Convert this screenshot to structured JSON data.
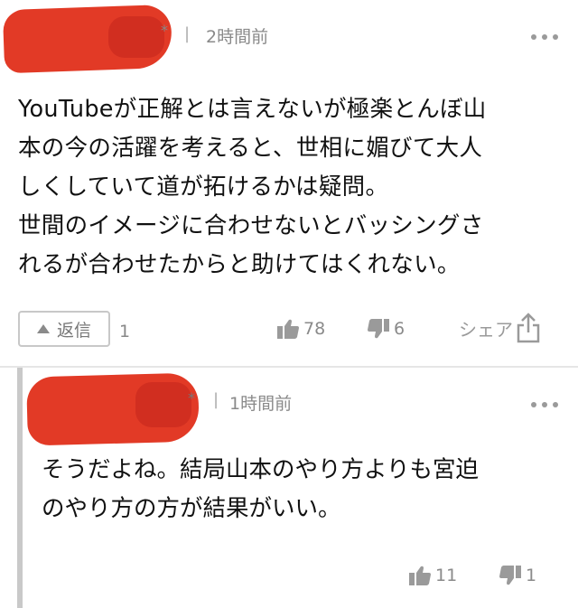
{
  "comment": {
    "time": "2時間前",
    "separator": "|",
    "marker": "*",
    "body": "YouTubeが正解とは言えないが極楽とんぼ山\n本の今の活躍を考えると、世相に媚びて大人\nしくしていて道が拓けるかは疑問。\n世間のイメージに合わせないとバッシングさ\nれるが合わせたからと助けてはくれない。",
    "reply_label": "返信",
    "reply_count": "1",
    "likes": "78",
    "dislikes": "6",
    "share_label": "シェア"
  },
  "reply": {
    "time": "1時間前",
    "separator": "|",
    "marker": "*",
    "body": "そうだよね。結局山本のやり方よりも宮迫\nのやり方の方が結果がいい。",
    "likes": "11",
    "dislikes": "1"
  },
  "icons": {
    "more": "more-dots-icon",
    "like": "thumbs-up-icon",
    "dislike": "thumbs-down-icon",
    "share": "share-icon",
    "reply": "triangle-up-icon"
  },
  "colors": {
    "redaction": "#e23a26",
    "muted": "#8a8a8a",
    "thread_bar": "#c9c9c9"
  }
}
